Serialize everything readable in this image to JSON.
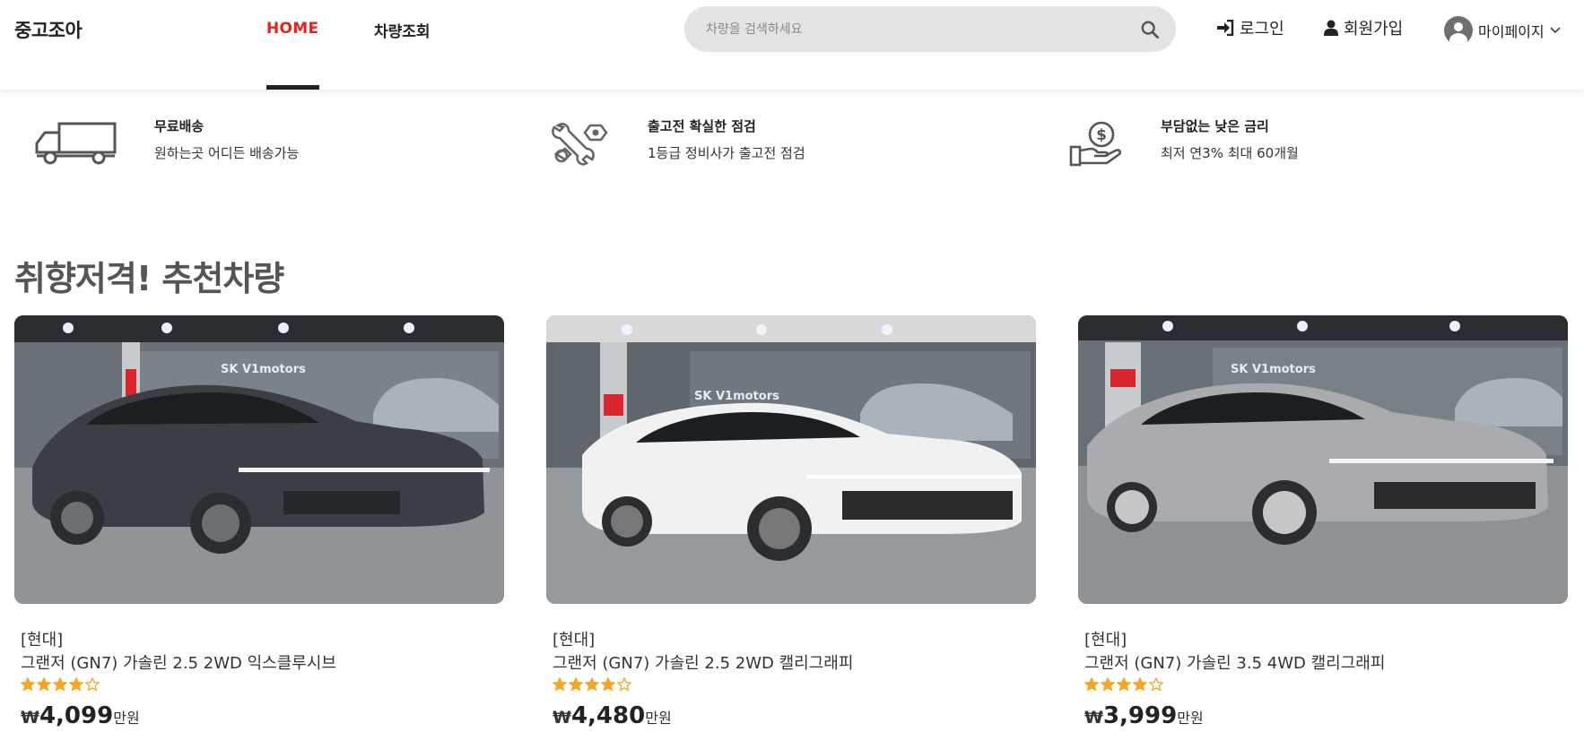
{
  "header": {
    "logo": "중고조아",
    "nav": {
      "home": "HOME",
      "search_cars": "차량조회"
    },
    "search": {
      "placeholder": "차량을 검색하세요",
      "value": ""
    },
    "login": "로그인",
    "signup": "회원가입",
    "mypage": "마이페이지"
  },
  "features": [
    {
      "icon": "truck-icon",
      "title": "무료배송",
      "desc": "원하는곳 어디든 배송가능"
    },
    {
      "icon": "tools-icon",
      "title": "출고전 확실한 점검",
      "desc": "1등급 정비사가 출고전 점검"
    },
    {
      "icon": "money-hand-icon",
      "title": "부담없는 낮은 금리",
      "desc": "최저 연3% 최대 60개월"
    }
  ],
  "section_title": "취향저격! 추천차량",
  "cars": [
    {
      "brand": "[현대]",
      "model": "그랜저 (GN7) 가솔린 2.5 2WD 익스클루시브",
      "rating": 4,
      "rating_max": 5,
      "currency": "₩",
      "price": "4,099",
      "unit": "만원",
      "car_color": "#3b3f45",
      "dealer_sign": "SK V1motors"
    },
    {
      "brand": "[현대]",
      "model": "그랜저 (GN7) 가솔린 2.5 2WD 캘리그래피",
      "rating": 4,
      "rating_max": 5,
      "currency": "₩",
      "price": "4,480",
      "unit": "만원",
      "car_color": "#f1f1f1",
      "dealer_sign": "SK V1motors"
    },
    {
      "brand": "[현대]",
      "model": "그랜저 (GN7) 가솔린 3.5 4WD 캘리그래피",
      "rating": 4,
      "rating_max": 5,
      "currency": "₩",
      "price": "3,999",
      "unit": "만원",
      "car_color": "#a9abae",
      "dealer_sign": "SK V1motors"
    }
  ],
  "colors": {
    "accent": "#e5231b",
    "star": "#f5a623",
    "search_bg": "#e3e3e3"
  }
}
